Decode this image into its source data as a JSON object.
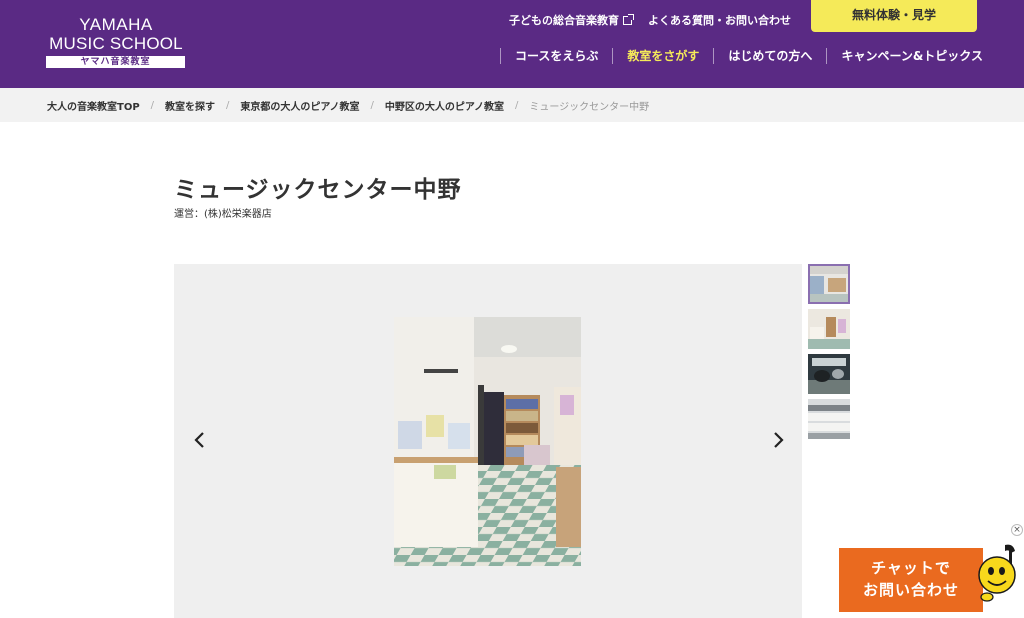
{
  "brand": {
    "logo_line1": "YAMAHA",
    "logo_line2": "MUSIC SCHOOL",
    "logo_line3": "ヤマハ音楽教室",
    "color": "#5a2a84"
  },
  "header": {
    "util_links": [
      {
        "label": "子どもの総合音楽教育",
        "icon": "external-link-icon"
      },
      {
        "label": "よくある質問・お問い合わせ"
      }
    ],
    "cta_label": "無料体験・見学",
    "nav": [
      {
        "label": "コースをえらぶ"
      },
      {
        "label": "教室をさがす",
        "active": true
      },
      {
        "label": "はじめての方へ"
      },
      {
        "label": "キャンペーン&トピックス"
      }
    ]
  },
  "breadcrumb": [
    "大人の音楽教室TOP",
    "教室を探す",
    "東京都の大人のピアノ教室",
    "中野区の大人のピアノ教室",
    "ミュージックセンター中野"
  ],
  "page": {
    "title": "ミュージックセンター中野",
    "operator": "運営：(株)松栄楽器店"
  },
  "gallery": {
    "prev_icon": "chevron-left-icon",
    "next_icon": "chevron-right-icon",
    "main_photo": "music-center-lobby-photo",
    "thumbnails": [
      {
        "name": "lesson-room-thumbnail",
        "selected": true
      },
      {
        "name": "lobby-thumbnail"
      },
      {
        "name": "drum-room-thumbnail"
      },
      {
        "name": "electone-thumbnail"
      }
    ]
  },
  "chat": {
    "line1": "チャットで",
    "line2": "お問い合わせ",
    "close": "×",
    "color": "#ea6a1f"
  }
}
